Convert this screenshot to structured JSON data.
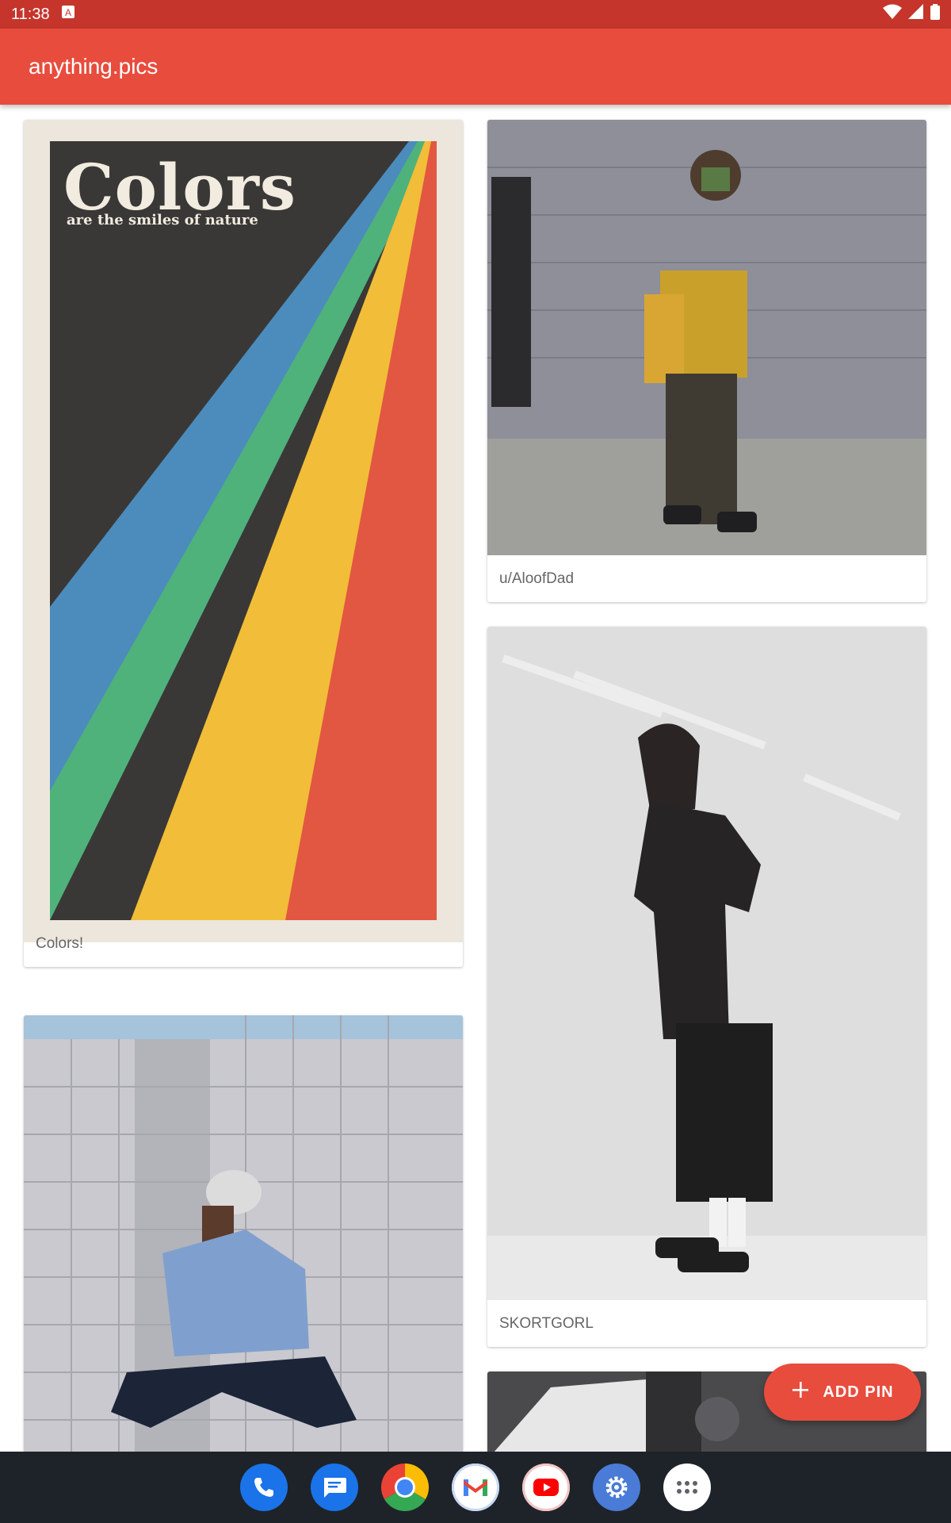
{
  "status_bar": {
    "time": "11:38",
    "notification_icon": "a-letter-icon",
    "icons": [
      "wifi-icon",
      "signal-icon",
      "battery-icon"
    ]
  },
  "app_bar": {
    "title": "anything.pics"
  },
  "pins": [
    {
      "caption": "Colors!",
      "image": "colors-poster",
      "poster_title": "Colors",
      "poster_subtitle": "are the smiles of nature"
    },
    {
      "caption": "u/AloofDad",
      "image": "streetwear-photo-yellow-jacket"
    },
    {
      "caption": "SKORTGORL",
      "image": "black-tshirt-photo"
    },
    {
      "caption": "",
      "image": "denim-jacket-photo"
    },
    {
      "caption": "",
      "image": "partial-photo"
    }
  ],
  "fab": {
    "label": "ADD PIN",
    "icon": "plus-icon"
  },
  "dock": [
    {
      "name": "phone",
      "icon": "phone-icon",
      "color": "#1a73e8"
    },
    {
      "name": "messages",
      "icon": "messages-icon",
      "color": "#1a73e8"
    },
    {
      "name": "chrome",
      "icon": "chrome-icon",
      "color": "#ffffff"
    },
    {
      "name": "gmail",
      "icon": "gmail-icon",
      "color": "#ffffff"
    },
    {
      "name": "youtube",
      "icon": "youtube-icon",
      "color": "#ffffff"
    },
    {
      "name": "settings",
      "icon": "settings-icon",
      "color": "#4a7bd6"
    },
    {
      "name": "app-drawer",
      "icon": "app-drawer-icon",
      "color": "#ffffff"
    }
  ],
  "colors": {
    "app_bar": "#e84c3d",
    "status_bar": "#c5352b",
    "nav_bar": "#1e2329"
  }
}
